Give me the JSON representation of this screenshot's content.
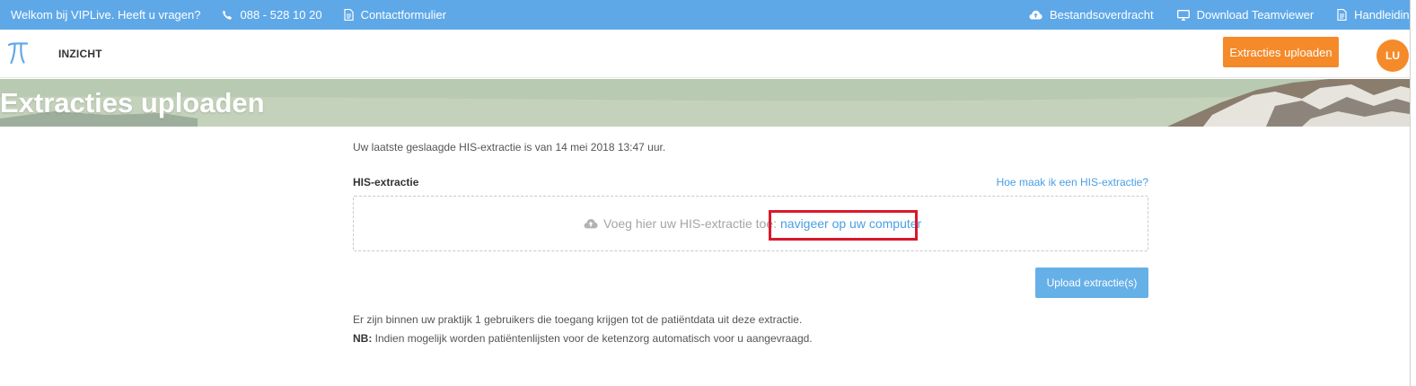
{
  "topbar": {
    "welcome": "Welkom bij VIPLive. Heeft u vragen?",
    "phone": "088 - 528 10 20",
    "contact": "Contactformulier",
    "file_transfer": "Bestandsoverdracht",
    "teamviewer": "Download Teamviewer",
    "manuals": "Handleidingen"
  },
  "navbar": {
    "nav_item": "INZICHT",
    "upload_button": "Extracties uploaden",
    "avatar_initials": "LU"
  },
  "hero": {
    "title": "Extracties uploaden"
  },
  "main": {
    "last_extract": "Uw laatste geslaagde HIS-extractie is van 14 mei 2018 13:47 uur.",
    "his_label": "HIS-extractie",
    "help_link": "Hoe maak ik een HIS-extractie?",
    "dropzone_text": "Voeg hier uw HIS-extractie toe:",
    "dropzone_link": "navigeer op uw computer",
    "upload_button": "Upload extractie(s)",
    "note_users": "Er zijn binnen uw praktijk 1 gebruikers die toegang krijgen tot de patiëntdata uit deze extractie.",
    "note_nb_label": "NB:",
    "note_nb_text": "Indien mogelijk worden patiëntenlijsten voor de ketenzorg automatisch voor u aangevraagd."
  },
  "colors": {
    "topbar": "#5fa8e8",
    "accent_orange": "#f58a2a",
    "link_blue": "#4a9ee3",
    "upload_button": "#66b0e8",
    "highlight_red": "#d9182b"
  },
  "icons": [
    "phone-icon",
    "document-icon",
    "cloud-upload-icon",
    "monitor-icon",
    "pi-logo-icon"
  ]
}
